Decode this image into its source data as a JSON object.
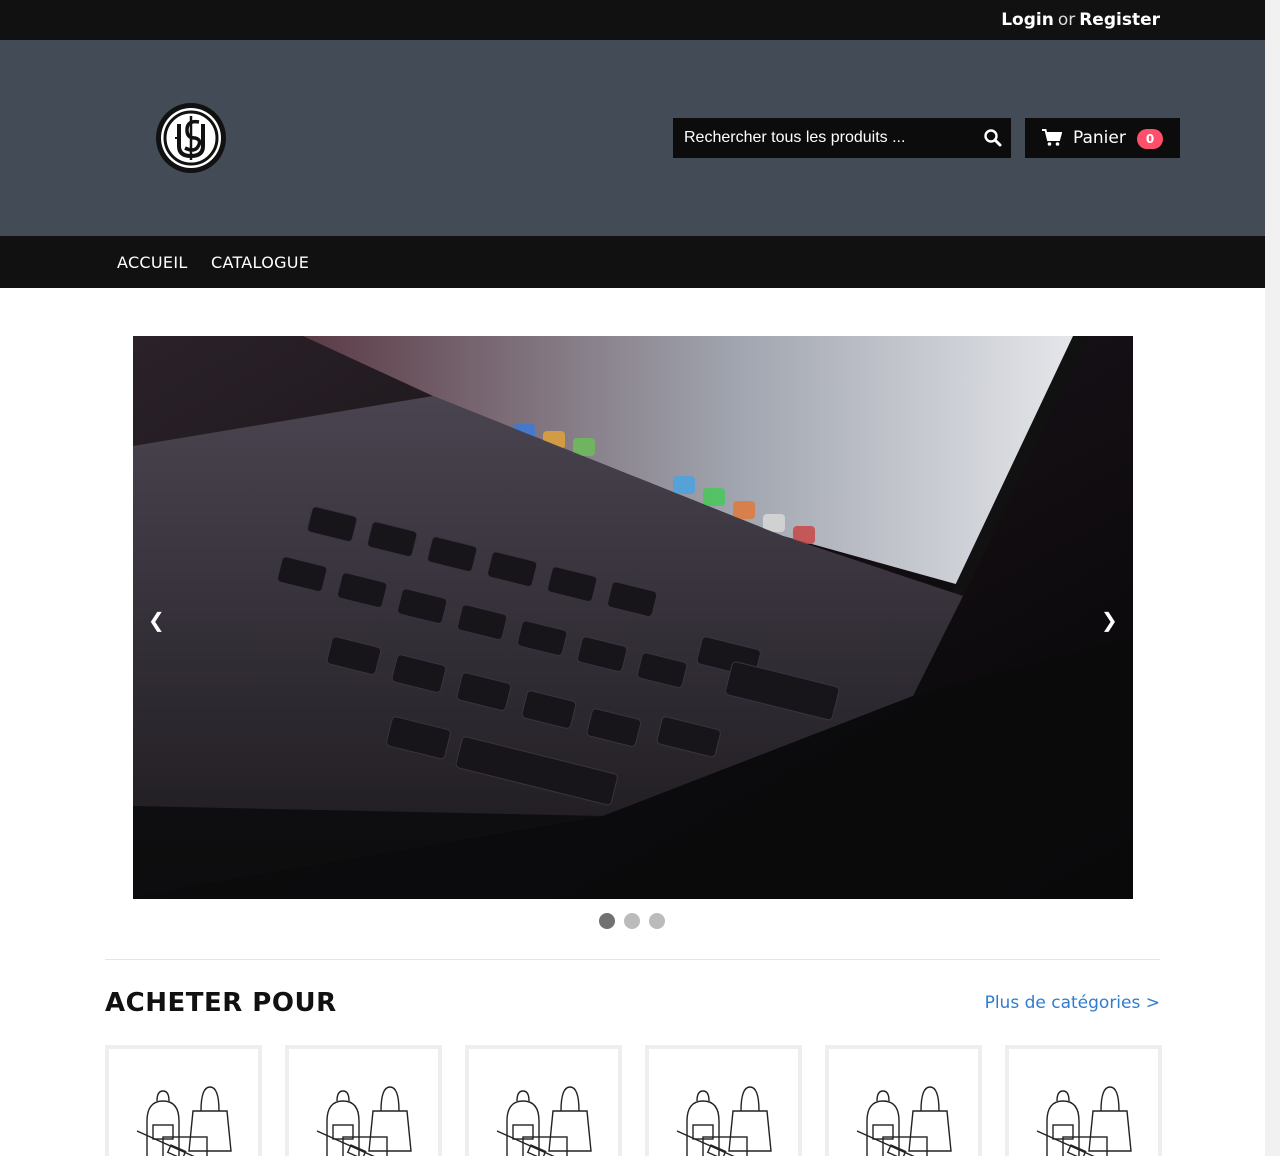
{
  "auth": {
    "login": "Login",
    "or": "or",
    "register": "Register"
  },
  "header": {
    "logo_icon": "circle-monogram-logo",
    "search": {
      "placeholder": "Rechercher tous les produits ...",
      "icon": "search-icon"
    },
    "cart": {
      "label": "Panier",
      "count": "0",
      "icon": "cart-icon"
    }
  },
  "nav": {
    "items": [
      {
        "label": "ACCUEIL"
      },
      {
        "label": "CATALOGUE"
      }
    ]
  },
  "slider": {
    "prev": "❮",
    "next": "❯",
    "slide_count": 3,
    "active_slide": 1,
    "image_subject": "laptop-keyboard-photo"
  },
  "categories": {
    "title": "ACHETER POUR",
    "more_link": "Plus de catégories >",
    "card_icon": "bags-illustration-icon",
    "card_count": 6
  },
  "colors": {
    "topbar": "#111111",
    "header": "#424b56",
    "accent_badge": "#ff4f6a",
    "link": "#2f7ccf"
  }
}
